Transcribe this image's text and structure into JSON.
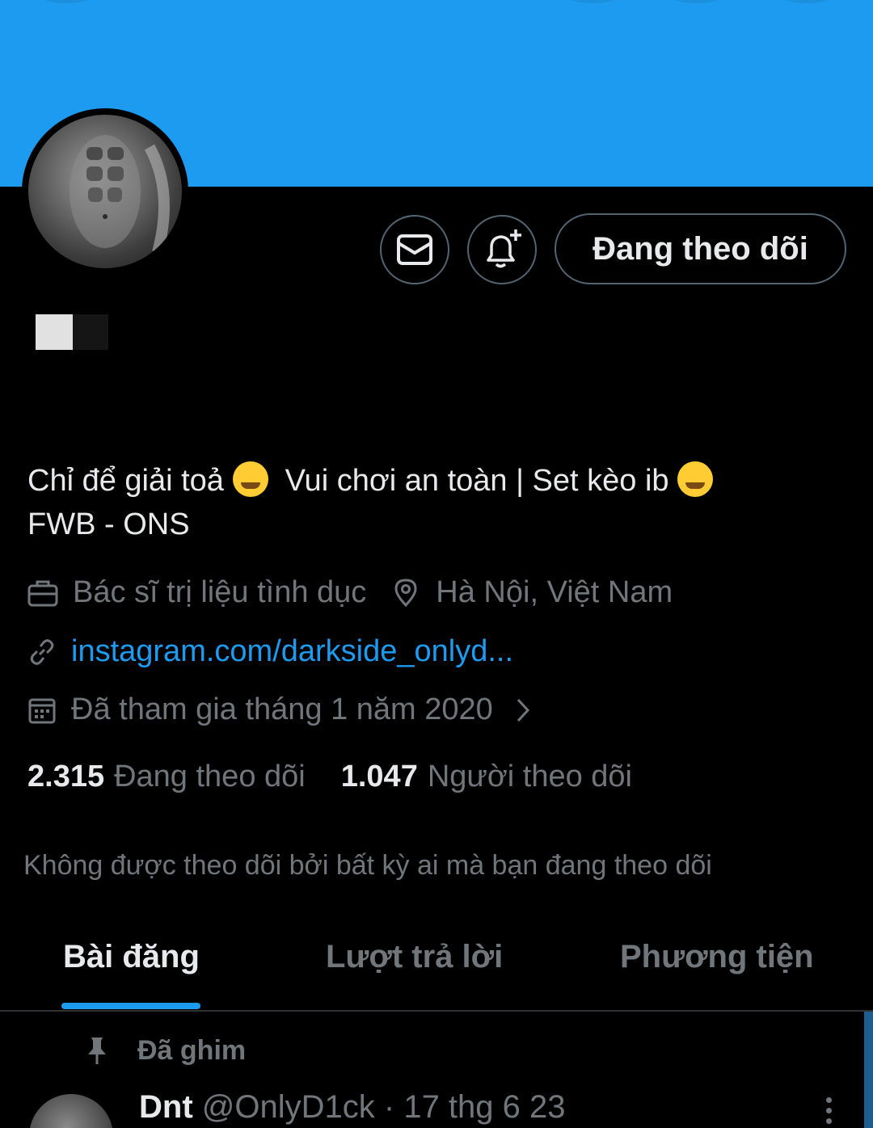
{
  "profile": {
    "follow_button_label": "Đang theo dõi",
    "bio_line1_a": "Chỉ để giải toả",
    "bio_line1_b": "Vui chơi an toàn |  Set kèo ib",
    "bio_line2": "FWB - ONS",
    "emoji_1": "yawning-face-emoji",
    "emoji_2": "drooling-face-emoji",
    "occupation": "Bác sĩ trị liệu tình dục",
    "location": "Hà Nội, Việt Nam",
    "website": "instagram.com/darkside_onlyd...",
    "joined": "Đã tham gia tháng 1 năm 2020",
    "following_count": "2.315",
    "following_label": "Đang theo dõi",
    "followers_count": "1.047",
    "followers_label": "Người theo dõi",
    "not_followed_note": "Không được theo dõi bởi bất kỳ ai mà bạn đang theo dõi"
  },
  "tabs": [
    {
      "label": "Bài đăng",
      "active": true
    },
    {
      "label": "Lượt trả lời",
      "active": false
    },
    {
      "label": "Phương tiện",
      "active": false
    }
  ],
  "pinned_post": {
    "pinned_label": "Đã ghim",
    "author_name": "Dnt",
    "author_handle": "@OnlyD1ck",
    "separator": "·",
    "date": "17 thg 6 23"
  },
  "icons": {
    "message": "mail-icon",
    "notify": "bell-plus-icon",
    "occupation": "briefcase-icon",
    "location": "location-pin-icon",
    "website": "link-icon",
    "joined": "calendar-icon",
    "joined_arrow": "chevron-right-icon",
    "pinned": "pin-icon",
    "more": "more-vertical-icon"
  },
  "colors": {
    "accent": "#1d9bf0",
    "background": "#000000",
    "text_primary": "#e7e9ea",
    "text_secondary": "#71767b",
    "border": "#536471"
  }
}
